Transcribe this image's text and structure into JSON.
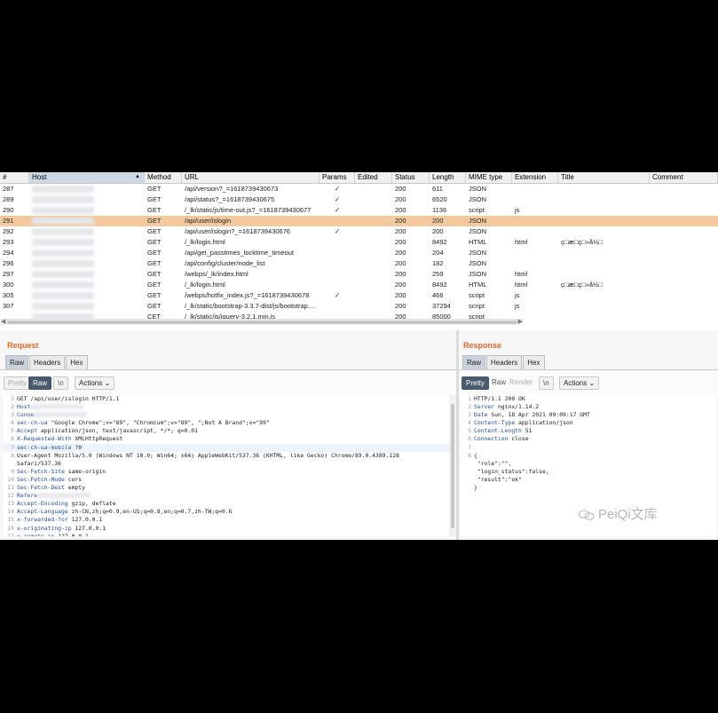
{
  "history": {
    "columns": [
      "#",
      "Host",
      "Method",
      "URL",
      "Params",
      "Edited",
      "Status",
      "Length",
      "MIME type",
      "Extension",
      "Title",
      "Comment"
    ],
    "selected_id": "291",
    "rows": [
      {
        "id": "287",
        "method": "GET",
        "url": "/api/version?_=1618739430673",
        "params": "✓",
        "status": "200",
        "length": "611",
        "mime": "JSON",
        "ext": "",
        "title": ""
      },
      {
        "id": "289",
        "method": "GET",
        "url": "/api/status?_=1618739430675",
        "params": "✓",
        "status": "200",
        "length": "6520",
        "mime": "JSON",
        "ext": "",
        "title": ""
      },
      {
        "id": "290",
        "method": "GET",
        "url": "/_lk/static/js/time-out.js?_=1618739430677",
        "params": "✓",
        "status": "200",
        "length": "1136",
        "mime": "script",
        "ext": "js",
        "title": ""
      },
      {
        "id": "291",
        "method": "GET",
        "url": "/api/user/islogin",
        "params": "",
        "status": "200",
        "length": "200",
        "mime": "JSON",
        "ext": "",
        "title": ""
      },
      {
        "id": "292",
        "method": "GET",
        "url": "/api/user/islogin?_=1618739430676",
        "params": "✓",
        "status": "200",
        "length": "200",
        "mime": "JSON",
        "ext": "",
        "title": ""
      },
      {
        "id": "293",
        "method": "GET",
        "url": "/_lk/login.html",
        "params": "",
        "status": "200",
        "length": "8492",
        "mime": "HTML",
        "ext": "html",
        "title": "ç□æ□ç□»å½□"
      },
      {
        "id": "294",
        "method": "GET",
        "url": "/api/get_passtimes_locktime_timeout",
        "params": "",
        "status": "200",
        "length": "204",
        "mime": "JSON",
        "ext": "",
        "title": ""
      },
      {
        "id": "296",
        "method": "GET",
        "url": "/api/config/cluster/node_list",
        "params": "",
        "status": "200",
        "length": "182",
        "mime": "JSON",
        "ext": "",
        "title": ""
      },
      {
        "id": "297",
        "method": "GET",
        "url": "/webps/_lk/index.html",
        "params": "",
        "status": "200",
        "length": "259",
        "mime": "JSON",
        "ext": "html",
        "title": ""
      },
      {
        "id": "300",
        "method": "GET",
        "url": "/_lk/login.html",
        "params": "",
        "status": "200",
        "length": "8492",
        "mime": "HTML",
        "ext": "html",
        "title": "ç□æ□ç□»å½□"
      },
      {
        "id": "305",
        "method": "GET",
        "url": "/webps/hotfix_index.js?_=1618739430678",
        "params": "✓",
        "status": "200",
        "length": "466",
        "mime": "script",
        "ext": "js",
        "title": ""
      },
      {
        "id": "307",
        "method": "GET",
        "url": "/_lk/static/bootstrap-3.3.7-dist/js/bootstrap....",
        "params": "",
        "status": "200",
        "length": "37294",
        "mime": "script",
        "ext": "js",
        "title": ""
      },
      {
        "id": "",
        "method": "CET",
        "url": "/_lk/static/js/jquery-3.2.1.min.js",
        "params": "",
        "status": "200",
        "length": "85000",
        "mime": "script",
        "ext": "",
        "title": ""
      }
    ]
  },
  "request": {
    "title": "Request",
    "tabs": [
      "Raw",
      "Headers",
      "Hex"
    ],
    "active_tab": "Raw",
    "buttons": {
      "pretty": "Pretty",
      "raw": "Raw",
      "newline": "\\n",
      "actions": "Actions"
    },
    "lines": [
      {
        "n": "1",
        "key": "",
        "val": "GET /api/user/islogin HTTP/1.1"
      },
      {
        "n": "2",
        "key": "Host",
        "val": ""
      },
      {
        "n": "3",
        "key": "Conne",
        "val": ""
      },
      {
        "n": "4",
        "key": "sec-ch-ua",
        "val": " \"Google Chrome\";v=\"89\", \"Chromium\";v=\"89\", \";Not A Brand\";v=\"99\""
      },
      {
        "n": "5",
        "key": "Accept",
        "val": " application/json, text/javascript, */*; q=0.01"
      },
      {
        "n": "6",
        "key": "X-Requested-With",
        "val": " XMLHttpRequest"
      },
      {
        "n": "7",
        "key": "sec-ch-ua-mobile",
        "val": " ?0"
      },
      {
        "n": "8",
        "key": "",
        "val": "User-Agent  Mozilla/5.0 (Windows NT 10.0; Win64; x64) AppleWebKit/537.36 (KHTML, like Gecko) Chrome/89.0.4389.128"
      },
      {
        "n": "",
        "key": "",
        "val": "Safari/537.36"
      },
      {
        "n": "9",
        "key": "Sec-Fetch-Site",
        "val": " same-origin"
      },
      {
        "n": "10",
        "key": "Sec-Fetch-Mode",
        "val": " cors"
      },
      {
        "n": "11",
        "key": "Sec-Fetch-Dest",
        "val": " empty"
      },
      {
        "n": "12",
        "key": "Refere",
        "val": ""
      },
      {
        "n": "13",
        "key": "Accept-Encoding",
        "val": " gzip, deflate"
      },
      {
        "n": "14",
        "key": "Accept-Language",
        "val": " zh-CN,zh;q=0.9,en-US;q=0.8,en;q=0.7,zh-TW;q=0.6"
      },
      {
        "n": "15",
        "key": "x-forwarded-for",
        "val": " 127.0.0.1"
      },
      {
        "n": "16",
        "key": "x-originating-ip",
        "val": " 127.0.0.1"
      },
      {
        "n": "17",
        "key": "x-remote-ip",
        "val": " 127.0.0.1"
      }
    ]
  },
  "response": {
    "title": "Response",
    "tabs": [
      "Raw",
      "Headers",
      "Hex"
    ],
    "active_tab": "Raw",
    "buttons": {
      "pretty": "Pretty",
      "raw": "Raw",
      "render": "Render",
      "newline": "\\n",
      "actions": "Actions"
    },
    "lines": [
      {
        "n": "1",
        "key": "",
        "val": "HTTP/1.1 200 OK"
      },
      {
        "n": "2",
        "key": "Server",
        "val": " nginx/1.14.2"
      },
      {
        "n": "3",
        "key": "Date",
        "val": " Sun, 18 Apr 2021 09:09:17 GMT"
      },
      {
        "n": "4",
        "key": "Content-Type",
        "val": " application/json"
      },
      {
        "n": "5",
        "key": "Content-Length",
        "val": " 51"
      },
      {
        "n": "6",
        "key": "Connection",
        "val": " close"
      },
      {
        "n": "7",
        "key": "",
        "val": ""
      },
      {
        "n": "8",
        "key": "",
        "val": "{"
      },
      {
        "n": "",
        "key": "",
        "val": "  \"role\":\"\","
      },
      {
        "n": "",
        "key": "",
        "val": "  \"login_status\":false,"
      },
      {
        "n": "",
        "key": "",
        "val": "  \"result\":\"ok\""
      },
      {
        "n": "",
        "key": "",
        "val": "}"
      }
    ]
  },
  "watermark": "PeiQi文库",
  "colors": {
    "accent": "#e8632b",
    "selected_row": "#f5c99e",
    "active_button": "#4a5a6e"
  }
}
